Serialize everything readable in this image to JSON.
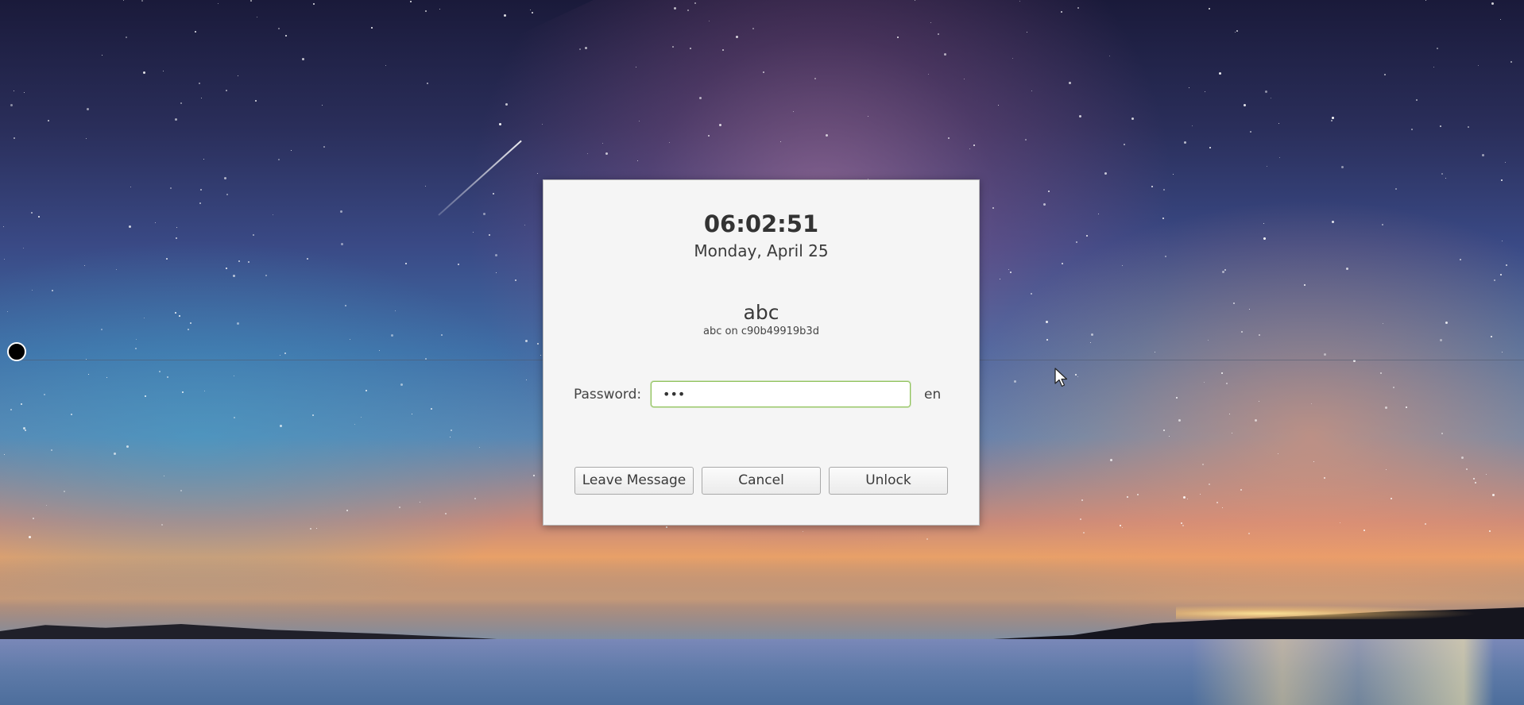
{
  "clock": {
    "time": "06:02:51",
    "date": "Monday, April 25"
  },
  "user": {
    "name": "abc",
    "host_line": "abc on c90b49919b3d"
  },
  "password": {
    "label": "Password:",
    "value": "•••",
    "language": "en"
  },
  "buttons": {
    "leave_message": "Leave Message",
    "cancel": "Cancel",
    "unlock": "Unlock"
  },
  "icons": {
    "record": "record-dot-icon",
    "cursor": "mouse-pointer-icon"
  },
  "colors": {
    "dialog_bg": "#f5f5f5",
    "focus_border": "#8fc25a"
  }
}
